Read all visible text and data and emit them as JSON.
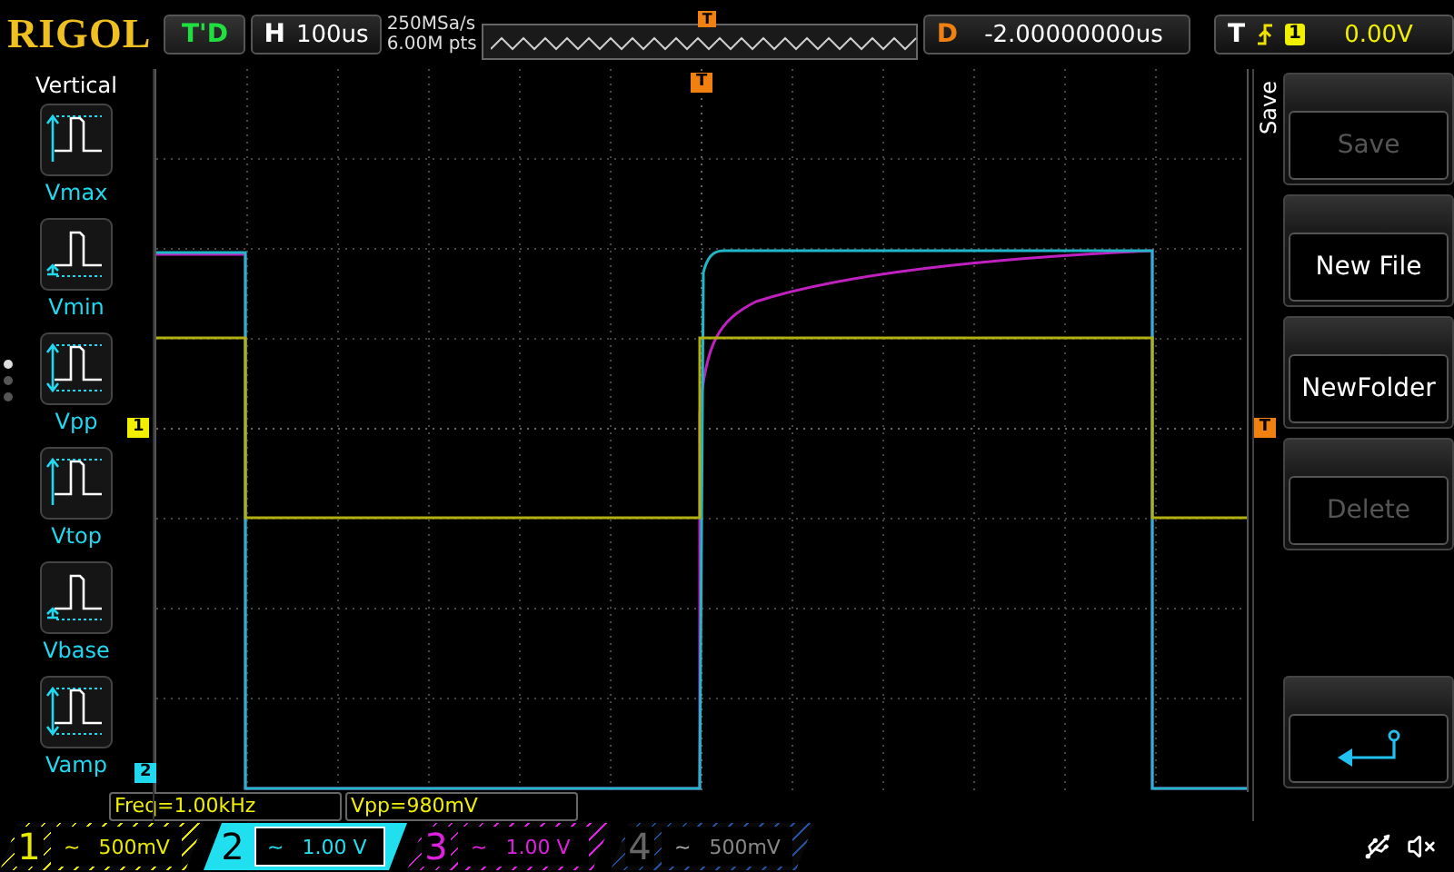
{
  "logo": "RIGOL",
  "run_status": "T'D",
  "horizontal": {
    "label": "H",
    "timebase": "100us",
    "sample_rate": "250MSa/s",
    "memory_depth": "6.00M pts"
  },
  "memory_bar": {
    "trigger_marker": "T"
  },
  "delay": {
    "label": "D",
    "value": "-2.00000000us"
  },
  "trigger": {
    "label": "T",
    "source": "1",
    "level": "0.00V"
  },
  "left_menu": {
    "title": "Vertical",
    "items": [
      {
        "label": "Vmax",
        "kind": "max"
      },
      {
        "label": "Vmin",
        "kind": "min"
      },
      {
        "label": "Vpp",
        "kind": "pp"
      },
      {
        "label": "Vtop",
        "kind": "max"
      },
      {
        "label": "Vbase",
        "kind": "min"
      },
      {
        "label": "Vamp",
        "kind": "pp"
      }
    ],
    "pages": [
      {
        "selected": true
      },
      {
        "selected": false
      },
      {
        "selected": false
      }
    ]
  },
  "graticule": {
    "trigger_position": "T",
    "trigger_level": "T",
    "channel_markers": [
      {
        "label": "1",
        "color": "#f0f000"
      },
      {
        "label": "2",
        "color": "#20d8f0"
      }
    ]
  },
  "measurements": [
    "Freq=1.00kHz",
    "Vpp=980mV"
  ],
  "right_menu": {
    "title": "Save",
    "buttons": [
      {
        "kind": "text",
        "label": "Save",
        "disabled": true
      },
      {
        "kind": "text",
        "label": "New File",
        "disabled": false
      },
      {
        "kind": "text",
        "label": "NewFolder",
        "disabled": false
      },
      {
        "kind": "text",
        "label": "Delete",
        "disabled": true
      },
      {
        "kind": "back",
        "disabled": false
      }
    ]
  },
  "channels": [
    {
      "number": "1",
      "coupling": "~",
      "scale": "500mV",
      "color": "#e8e800",
      "selected": false,
      "on": true
    },
    {
      "number": "2",
      "coupling": "~",
      "scale": "1.00 V",
      "color": "#20e0f0",
      "selected": true,
      "on": true
    },
    {
      "number": "3",
      "coupling": "~",
      "scale": "1.00 V",
      "color": "#e020e0",
      "selected": false,
      "on": true
    },
    {
      "number": "4",
      "coupling": "~",
      "scale": "500mV",
      "color": "#2050a0",
      "selected": false,
      "on": false
    }
  ]
}
